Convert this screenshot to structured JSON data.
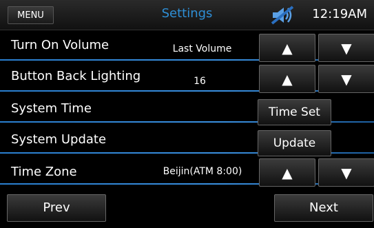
{
  "header": {
    "menu_label": "MENU",
    "title": "Settings",
    "status_icon": "muted-speaker-icon",
    "time": "12:19AM"
  },
  "rows": [
    {
      "label": "Turn On Volume",
      "value": "Last Volume",
      "up": "▲",
      "down": "▼"
    },
    {
      "label": "Button Back Lighting",
      "value": "16",
      "up": "▲",
      "down": "▼"
    },
    {
      "label": "System Time",
      "button": "Time Set"
    },
    {
      "label": "System Update",
      "button": "Update"
    },
    {
      "label": "Time Zone",
      "value": "Beijin(ATM 8:00)",
      "up": "▲",
      "down": "▼"
    }
  ],
  "footer": {
    "prev_label": "Prev",
    "next_label": "Next"
  },
  "colors": {
    "accent": "#2e8fd6",
    "background": "#000000"
  }
}
